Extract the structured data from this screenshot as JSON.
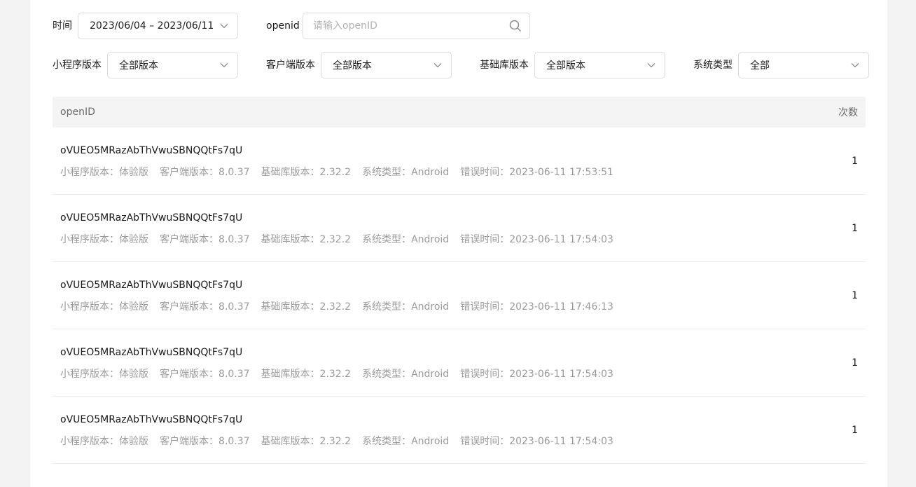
{
  "filters": {
    "time": {
      "label": "时间",
      "value": "2023/06/04 – 2023/06/11"
    },
    "openid": {
      "label": "openid",
      "placeholder": "请输入openID"
    },
    "miniapp_version": {
      "label": "小程序版本",
      "value": "全部版本"
    },
    "client_version": {
      "label": "客户端版本",
      "value": "全部版本"
    },
    "base_version": {
      "label": "基础库版本",
      "value": "全部版本"
    },
    "os_type": {
      "label": "系统类型",
      "value": "全部"
    }
  },
  "table": {
    "headers": {
      "openid": "openID",
      "count": "次数"
    },
    "field_labels": {
      "miniapp": "小程序版本：",
      "client": "客户端版本：",
      "base": "基础库版本：",
      "os": "系统类型：",
      "time": "错误时间："
    },
    "rows": [
      {
        "openid": "oVUEO5MRazAbThVwuSBNQQtFs7qU",
        "miniapp": "体验版",
        "client": "8.0.37",
        "base": "2.32.2",
        "os": "Android",
        "time": "2023-06-11 17:53:51",
        "count": "1"
      },
      {
        "openid": "oVUEO5MRazAbThVwuSBNQQtFs7qU",
        "miniapp": "体验版",
        "client": "8.0.37",
        "base": "2.32.2",
        "os": "Android",
        "time": "2023-06-11 17:54:03",
        "count": "1"
      },
      {
        "openid": "oVUEO5MRazAbThVwuSBNQQtFs7qU",
        "miniapp": "体验版",
        "client": "8.0.37",
        "base": "2.32.2",
        "os": "Android",
        "time": "2023-06-11 17:46:13",
        "count": "1"
      },
      {
        "openid": "oVUEO5MRazAbThVwuSBNQQtFs7qU",
        "miniapp": "体验版",
        "client": "8.0.37",
        "base": "2.32.2",
        "os": "Android",
        "time": "2023-06-11 17:54:03",
        "count": "1"
      },
      {
        "openid": "oVUEO5MRazAbThVwuSBNQQtFs7qU",
        "miniapp": "体验版",
        "client": "8.0.37",
        "base": "2.32.2",
        "os": "Android",
        "time": "2023-06-11 17:54:03",
        "count": "1"
      }
    ]
  }
}
